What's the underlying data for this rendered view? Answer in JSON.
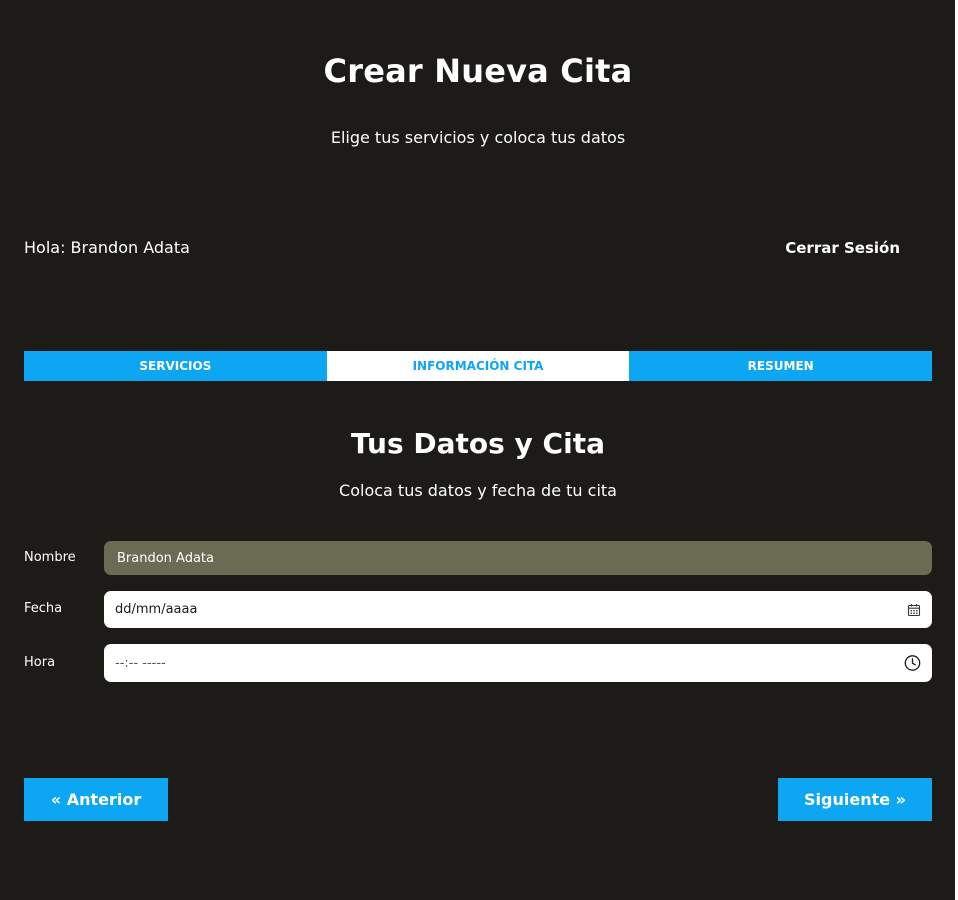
{
  "header": {
    "title": "Crear Nueva Cita",
    "subtitle": "Elige tus servicios y coloca tus datos"
  },
  "user_bar": {
    "greeting": "Hola: Brandon Adata",
    "logout_label": "Cerrar Sesión"
  },
  "tabs": [
    {
      "label": "SERVICIOS",
      "active": false
    },
    {
      "label": "INFORMACIÓN CITA",
      "active": true
    },
    {
      "label": "RESUMEN",
      "active": false
    }
  ],
  "section": {
    "title": "Tus Datos y Cita",
    "subtitle": "Coloca tus datos y fecha de tu cita"
  },
  "form": {
    "nombre": {
      "label": "Nombre",
      "value": "Brandon Adata"
    },
    "fecha": {
      "label": "Fecha",
      "placeholder": "dd/mm/aaaa",
      "icon": "calendar-icon"
    },
    "hora": {
      "label": "Hora",
      "placeholder": "--:-- -----",
      "icon": "clock-icon"
    }
  },
  "navigation": {
    "prev_label": "« Anterior",
    "next_label": "Siguiente »"
  },
  "colors": {
    "background": "#1c1b17",
    "accent": "#0da6f2",
    "disabled_field": "#6a6b53",
    "text": "#ffffff"
  }
}
